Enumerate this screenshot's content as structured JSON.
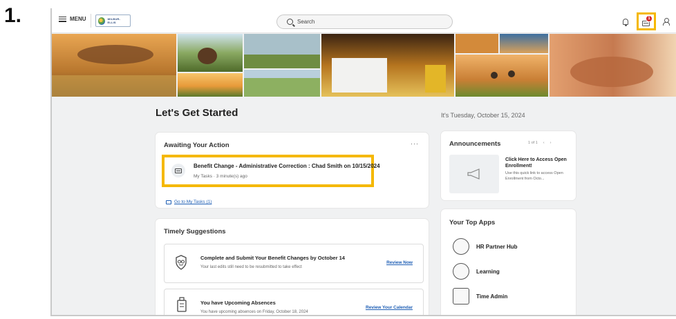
{
  "step_label": "1.",
  "topbar": {
    "menu_label": "MENU",
    "logo_text": "WILBUR-ELLIS",
    "search_placeholder": "Search",
    "notification_count": "1"
  },
  "page": {
    "title": "Let's Get Started",
    "date": "It's Tuesday, October 15, 2024"
  },
  "awaiting": {
    "title": "Awaiting Your Action",
    "more_label": "···",
    "task": {
      "title": "Benefit Change - Administrative Correction : Chad Smith on 10/15/2024",
      "subtitle": "My Tasks · 3 minute(s) ago"
    },
    "goto_link": "Go to My Tasks (1)"
  },
  "timely": {
    "title": "Timely Suggestions",
    "items": [
      {
        "title": "Complete and Submit Your Benefit Changes by October 14",
        "subtitle": "Your last edits still need to be resubmitted to take effect",
        "link": "Review Now",
        "icon": "shield-icon"
      },
      {
        "title": "You have Upcoming Absences",
        "subtitle": "You have upcoming absences on Friday, October 18, 2024",
        "link": "Review Your Calendar",
        "icon": "luggage-icon"
      }
    ]
  },
  "announcements": {
    "title": "Announcements",
    "pager": "1 of 1",
    "prev": "‹",
    "next": "›",
    "item_title": "Click Here to Access Open Enrollment!",
    "item_body": "Use this quick link to access Open Enrollment from Octo..."
  },
  "apps": {
    "title": "Your Top Apps",
    "items": [
      {
        "label": "HR Partner Hub",
        "icon": "hr-partner-hub-icon"
      },
      {
        "label": "Learning",
        "icon": "learning-icon"
      },
      {
        "label": "Time Admin",
        "icon": "time-admin-icon"
      }
    ]
  },
  "colors": {
    "highlight": "#f5b800",
    "link": "#1f5fb5",
    "badge": "#d62626",
    "background": "#f0f1f2"
  }
}
